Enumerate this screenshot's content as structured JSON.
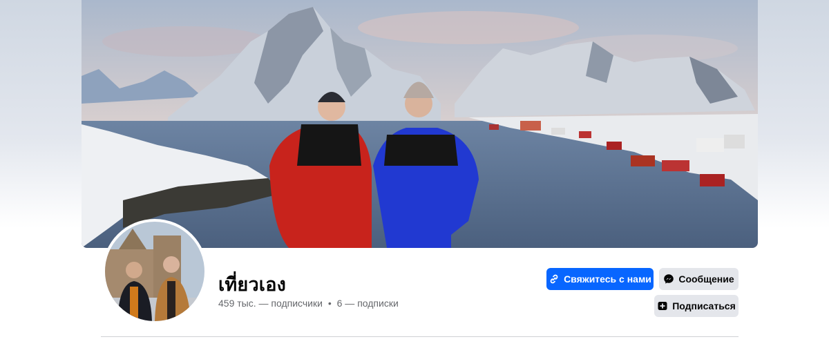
{
  "profile": {
    "name": "เที่ยวเอง",
    "followers": "459 тыс. — подписчики",
    "separator": "•",
    "following": "6 — подписки"
  },
  "actions": {
    "contact_label": "Свяжитесь с нами",
    "message_label": "Сообщение",
    "subscribe_label": "Подписаться"
  },
  "icons": {
    "contact": "link-icon",
    "message": "messenger-icon",
    "subscribe": "follow-icon"
  },
  "colors": {
    "primary": "#0866ff",
    "secondary_bg": "#e4e6eb",
    "text": "#050505",
    "muted": "#65676b"
  }
}
